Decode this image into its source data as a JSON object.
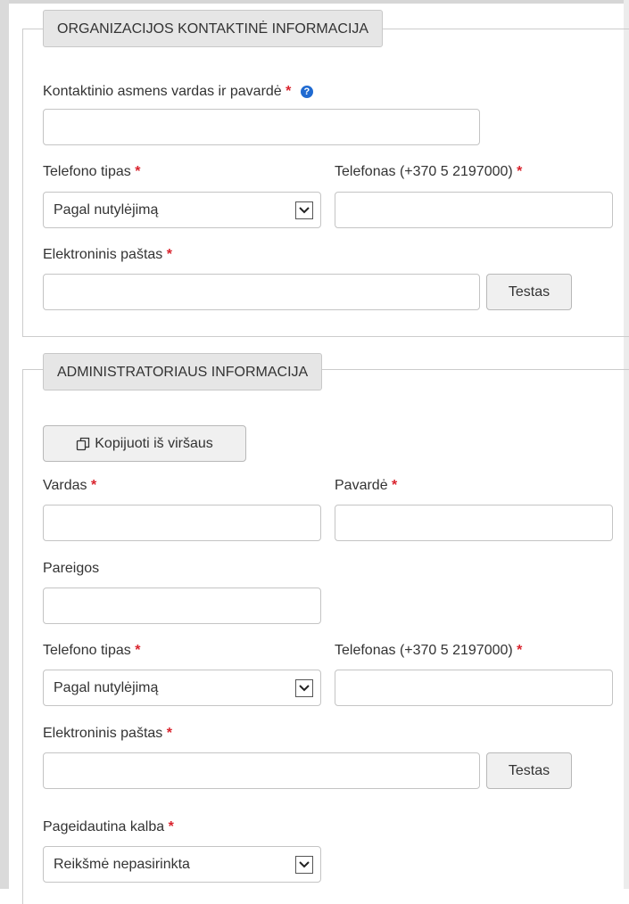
{
  "org_section": {
    "legend": "ORGANIZACIJOS KONTAKTINĖ INFORMACIJA",
    "contact_name_label": "Kontaktinio asmens vardas ir pavardė",
    "contact_name_value": "",
    "phone_type_label": "Telefono tipas",
    "phone_type_value": "Pagal nutylėjimą",
    "phone_label": "Telefonas (+370 5 2197000)",
    "phone_value": "",
    "email_label": "Elektroninis paštas",
    "email_value": "",
    "test_button": "Testas"
  },
  "admin_section": {
    "legend": "ADMINISTRATORIAUS INFORMACIJA",
    "copy_button": "Kopijuoti iš viršaus",
    "first_name_label": "Vardas",
    "last_name_label": "Pavardė",
    "position_label": "Pareigos",
    "phone_type_label": "Telefono tipas",
    "phone_type_value": "Pagal nutylėjimą",
    "phone_label": "Telefonas (+370 5 2197000)",
    "email_label": "Elektroninis paštas",
    "test_button": "Testas",
    "language_label": "Pageidautina kalba",
    "language_value": "Reikšmė nepasirinkta"
  },
  "required_mark": "*",
  "icons": {
    "help": "question-circle-icon",
    "copy": "copy-icon",
    "dropdown": "chevron-down-icon"
  },
  "colors": {
    "required": "#d9232d",
    "help_icon": "#1f6ad1",
    "legend_bg": "#e6e6e6"
  }
}
